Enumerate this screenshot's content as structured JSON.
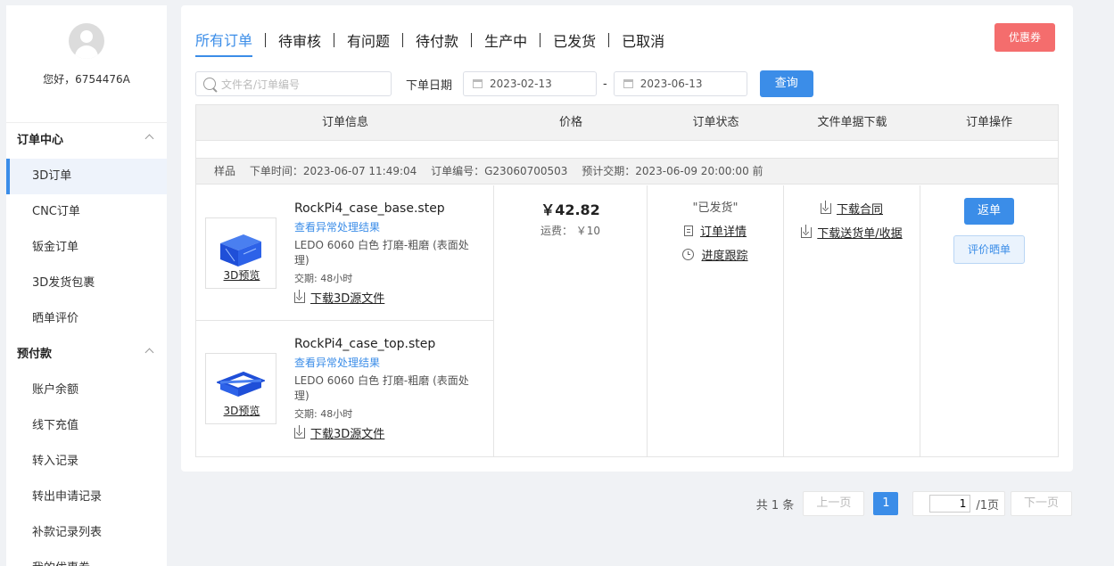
{
  "sidebar": {
    "greeting": "您好，6754476A",
    "groups": [
      {
        "title": "订单中心",
        "items": [
          "3D订单",
          "CNC订单",
          "钣金订单",
          "3D发货包裹",
          "晒单评价"
        ]
      },
      {
        "title": "预付款",
        "items": [
          "账户余额",
          "线下充值",
          "转入记录",
          "转出申请记录",
          "补款记录列表",
          "我的优惠券"
        ]
      }
    ]
  },
  "tabs": [
    "所有订单",
    "待审核",
    "有问题",
    "待付款",
    "生产中",
    "已发货",
    "已取消"
  ],
  "coupon_button": "优惠券",
  "search": {
    "placeholder": "文件名/订单编号",
    "date_label": "下单日期",
    "date_from": "2023-02-13",
    "date_sep": "-",
    "date_to": "2023-06-13",
    "query_button": "查询"
  },
  "table": {
    "headers": [
      "订单信息",
      "价格",
      "订单状态",
      "文件单据下载",
      "订单操作"
    ]
  },
  "order": {
    "type": "样品",
    "order_time": "下单时间：2023-06-07 11:49:04",
    "order_no": "订单编号：G23060700503",
    "delivery": "预计交期：2023-06-09 20:00:00 前",
    "price": "￥42.82",
    "shipping": "运费： ￥10",
    "status": "\"已发货\"",
    "detail_link": "订单详情",
    "track_link": "进度跟踪",
    "contract_link": "下载合同",
    "receipt_link": "下载送货单/收据",
    "return_button": "返单",
    "review_button": "评价晒单",
    "items": [
      {
        "preview": "3D预览",
        "filename": "RockPi4_case_base.step",
        "abnormal": "查看异常处理结果",
        "spec": "LEDO 6060  白色   打磨-粗磨 (表面处理)",
        "lead": "交期: 48小时",
        "download": "下载3D源文件"
      },
      {
        "preview": "3D预览",
        "filename": "RockPi4_case_top.step",
        "abnormal": "查看异常处理结果",
        "spec": "LEDO 6060  白色   打磨-粗磨 (表面处理)",
        "lead": "交期: 48小时",
        "download": "下载3D源文件"
      }
    ]
  },
  "pagination": {
    "total": "共 1 条",
    "prev": "上一页",
    "current": "1",
    "jump_value": "1",
    "pages": "/1页",
    "next": "下一页"
  },
  "colors": {
    "accent": "#3b8de8",
    "coupon": "#f46d6d"
  }
}
